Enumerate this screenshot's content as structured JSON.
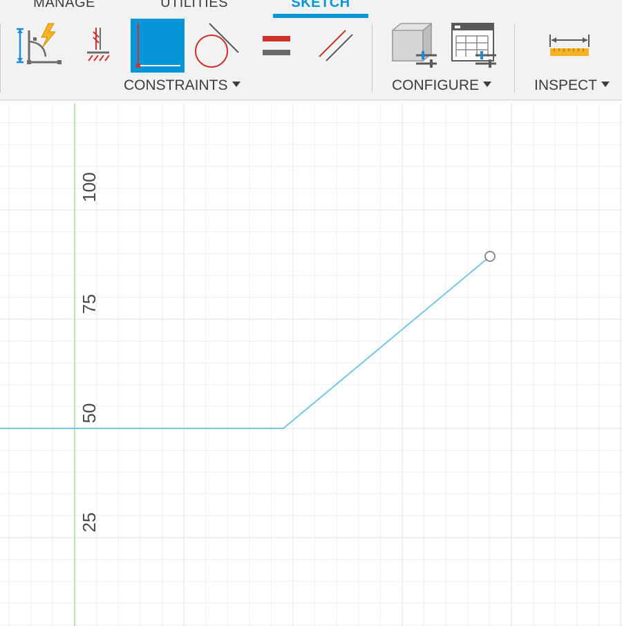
{
  "tabs": {
    "manage": "MANAGE",
    "utilities": "UTILITIES",
    "sketch": "SKETCH"
  },
  "groups": {
    "constraints": "CONSTRAINTS",
    "configure": "CONFIGURE",
    "inspect": "INSPECT"
  },
  "tools": [
    {
      "name": "fix-unfix-constraint",
      "icon": "fix-lightning-icon"
    },
    {
      "name": "coincident-constraint",
      "icon": "ground-hatch-icon"
    },
    {
      "name": "perpendicular-constraint",
      "icon": "perpendicular-icon",
      "active": true
    },
    {
      "name": "tangent-constraint",
      "icon": "tangent-circle-icon"
    },
    {
      "name": "equal-constraint",
      "icon": "equal-icon"
    },
    {
      "name": "parallel-constraint",
      "icon": "parallel-icon"
    },
    {
      "name": "change-parameters",
      "icon": "box-parameters-icon"
    },
    {
      "name": "configure-table",
      "icon": "table-parameters-icon"
    },
    {
      "name": "measure",
      "icon": "ruler-measure-icon"
    }
  ],
  "canvas": {
    "axis_tick_labels": [
      "100",
      "75",
      "50",
      "25"
    ]
  },
  "colors": {
    "accent": "#0696d7",
    "sketch_line": "#74c6e2",
    "y_axis": "#8fd68f",
    "constraint_red": "#d0312d",
    "grid_minor": "#efefef",
    "grid_major": "#e0e0e0"
  }
}
